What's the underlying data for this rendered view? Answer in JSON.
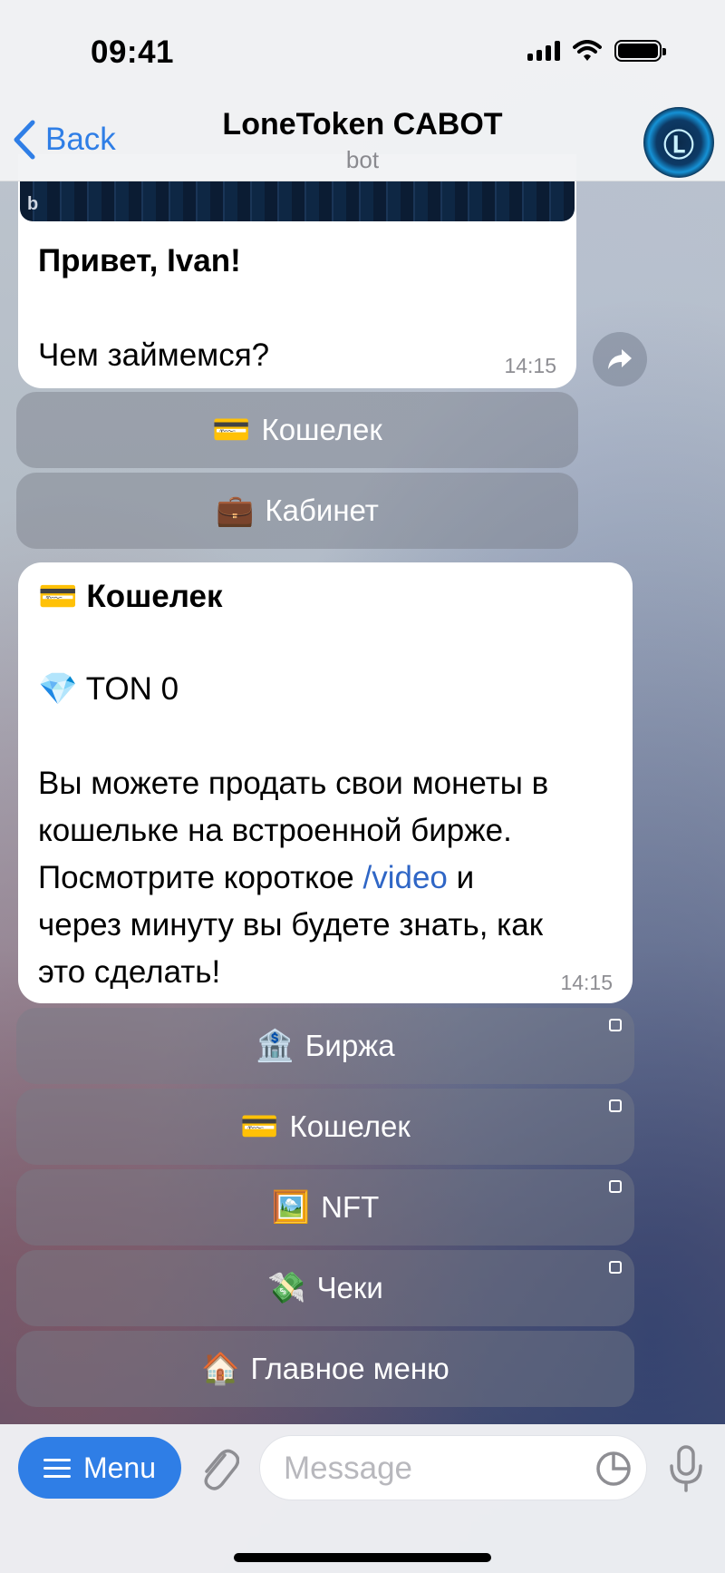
{
  "status_bar": {
    "time": "09:41"
  },
  "header": {
    "back_label": "Back",
    "title": "LoneToken CABOT",
    "subtitle": "bot",
    "avatar_letter": "Ⓛ"
  },
  "message1": {
    "greeting": "Привет, Ivan!",
    "question": "Чем займемся?",
    "time": "14:15"
  },
  "keyboard1": [
    {
      "emoji": "💳",
      "label": "Кошелек"
    },
    {
      "emoji": "💼",
      "label": "Кабинет"
    }
  ],
  "message2": {
    "heading_emoji": "💳",
    "heading": "Кошелек",
    "balance_emoji": "💎",
    "balance": "TON 0",
    "body_line1": "Вы можете продать свои монеты в",
    "body_line2": "кошельке на встроенной бирже.",
    "body_line3_pre": "Посмотрите короткое ",
    "body_link": "/video",
    "body_line3_post": " и",
    "body_line4": "через минуту вы будете знать, как",
    "body_line5": "это сделать!",
    "time": "14:15"
  },
  "keyboard2": [
    {
      "emoji": "🏦",
      "label": "Биржа",
      "webapp": true
    },
    {
      "emoji": "💳",
      "label": "Кошелек",
      "webapp": true
    },
    {
      "emoji": "🖼️",
      "label": "NFT",
      "webapp": true
    },
    {
      "emoji": "💸",
      "label": "Чеки",
      "webapp": true
    },
    {
      "emoji": "🏠",
      "label": "Главное меню",
      "webapp": false
    }
  ],
  "input_bar": {
    "menu_label": "Menu",
    "placeholder": "Message"
  }
}
